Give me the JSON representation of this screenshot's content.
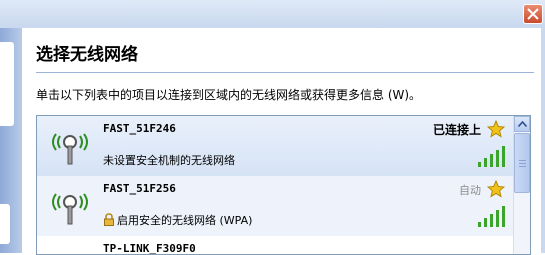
{
  "dialog": {
    "title": "选择无线网络",
    "instruction": "单击以下列表中的项目以连接到区域内的无线网络或获得更多信息 (W)。"
  },
  "networks": [
    {
      "ssid": "FAST_51F246",
      "status": "已连接上",
      "security": "未设置安全机制的无线网络",
      "signal_bars": 5,
      "icon": "wifi-antenna-icon"
    },
    {
      "ssid": "FAST_51F256",
      "status": "自动",
      "security": "启用安全的无线网络 (WPA)",
      "signal_bars": 5,
      "icon": "wifi-antenna-icon"
    },
    {
      "ssid": "TP-LINK_F309F0"
    }
  ],
  "colors": {
    "accent": "#7f9db9",
    "signal": "#3aa52a",
    "star": "#f2c21a"
  }
}
